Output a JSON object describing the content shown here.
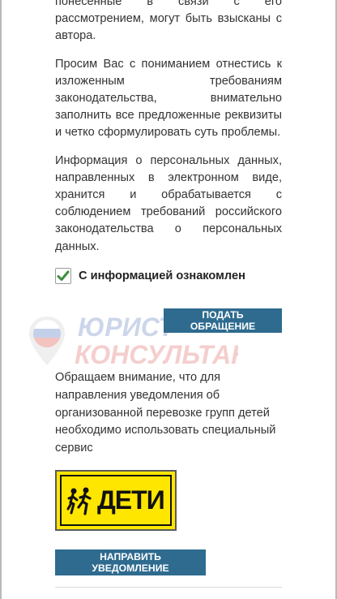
{
  "paragraphs": [
    "понесенные в связи с его рассмотрением, могут быть взысканы с автора.",
    "Просим Вас с пониманием отнестись к изложенным требованиям законодательства, внимательно заполнить все предложенные реквизиты и четко сформулировать суть проблемы.",
    "Информация о персональных данных, направленных в электронном виде, хранится и обрабатывается с соблюдением требований российского законодательства о персональных данных."
  ],
  "consent": {
    "label": "С информацией ознакомлен",
    "checked": true
  },
  "buttons": {
    "submit_label": "ПОДАТЬ ОБРАЩЕНИЕ",
    "notify_label": "НАПРАВИТЬ УВЕДОМЛЕНИЕ"
  },
  "watermark": {
    "line1": "ЮРИСТ",
    "line2": "КОНСУЛЬТАНТ"
  },
  "notice": "Обращаем внимание, что для направления уведомления об организованной перевозке групп детей необходимо использовать специальный сервис",
  "sign": {
    "text": "ДЕТИ",
    "icon": "children-crossing-icon"
  },
  "colors": {
    "button_bg": "#2e6b8f",
    "check": "#3c8d3c",
    "sign_yellow": "#ffe600"
  }
}
